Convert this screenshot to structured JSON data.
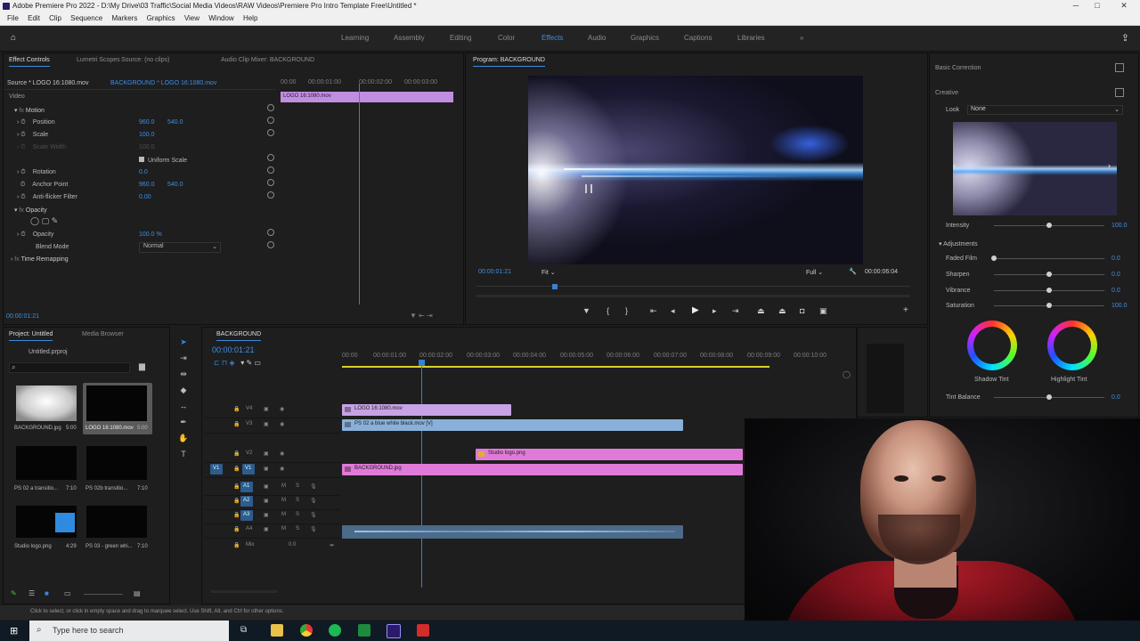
{
  "window": {
    "title": "Adobe Premiere Pro 2022 - D:\\My Drive\\03 Traffic\\Social Media Videos\\RAW Videos\\Premiere Pro Intro Template Free\\Untitled *",
    "controls": {
      "minimize": "─",
      "maximize": "□",
      "close": "✕"
    }
  },
  "menu": [
    "File",
    "Edit",
    "Clip",
    "Sequence",
    "Markers",
    "Graphics",
    "View",
    "Window",
    "Help"
  ],
  "workspaces": {
    "items": [
      "Learning",
      "Assembly",
      "Editing",
      "Color",
      "Effects",
      "Audio",
      "Graphics",
      "Captions",
      "Libraries"
    ],
    "active": "Effects",
    "more": "»"
  },
  "effect_controls": {
    "tabs": [
      "Effect Controls",
      "Lumetri Scopes",
      "Source: (no clips)",
      "Audio Clip Mixer: BACKGROUND"
    ],
    "source": "Source * LOGO 16:1080.mov",
    "sequence": "BACKGROUND * LOGO 16:1080.mov",
    "ruler": [
      "00:00",
      "00:00:01:00",
      "00:00:02:00",
      "00:00:03:00"
    ],
    "clip_name": "LOGO 16:1080.mov",
    "section_video": "Video",
    "motion": "Motion",
    "position": {
      "label": "Position",
      "x": "960.0",
      "y": "540.0"
    },
    "scale": {
      "label": "Scale",
      "value": "100.0"
    },
    "scale_width": {
      "label": "Scale Width",
      "value": "100.0"
    },
    "uniform_scale": "Uniform Scale",
    "rotation": {
      "label": "Rotation",
      "value": "0.0"
    },
    "anchor": {
      "label": "Anchor Point",
      "x": "960.0",
      "y": "540.0"
    },
    "antiflicker": {
      "label": "Anti-flicker Filter",
      "value": "0.00"
    },
    "opacity_section": "Opacity",
    "opacity": {
      "label": "Opacity",
      "value": "100.0 %"
    },
    "blend": {
      "label": "Blend Mode",
      "value": "Normal"
    },
    "time_remap": "Time Remapping",
    "timecode": "00:00:01:21"
  },
  "program": {
    "title": "Program: BACKGROUND",
    "timecode": "00:00:01:21",
    "fit": "Fit",
    "quality": "Full",
    "duration": "00:00:06:04",
    "controls": [
      "marker",
      "in",
      "out",
      "go-in",
      "step-back",
      "play",
      "step-forward",
      "go-out",
      "lift",
      "extract",
      "export-frame",
      "compare"
    ]
  },
  "lumetri": {
    "basic": "Basic Correction",
    "creative": "Creative",
    "look_label": "Look",
    "look_value": "None",
    "intensity": {
      "label": "Intensity",
      "value": "100.0"
    },
    "adjustments": "Adjustments",
    "sliders": [
      {
        "label": "Faded Film",
        "value": "0.0",
        "level": 0.0
      },
      {
        "label": "Sharpen",
        "value": "0.0",
        "level": 0.5
      },
      {
        "label": "Vibrance",
        "value": "0.0",
        "level": 0.5
      },
      {
        "label": "Saturation",
        "value": "100.0",
        "level": 0.5
      }
    ],
    "shadow_tint": "Shadow Tint",
    "highlight_tint": "Highlight Tint",
    "tint_balance": {
      "label": "Tint Balance",
      "value": "0.0"
    }
  },
  "project": {
    "tabs": [
      "Project: Untitled",
      "Media Browser"
    ],
    "project_file": "Untitled.prproj",
    "items": [
      {
        "name": "BACKGROUND.jpg",
        "meta": "5:00"
      },
      {
        "name": "LOGO 16:1080.mov",
        "meta": "5:00"
      },
      {
        "name": "PS 02 a transitio...",
        "meta": "7:10"
      },
      {
        "name": "PS 02b transitio...",
        "meta": "7:10"
      },
      {
        "name": "Studio logo.png",
        "meta": "4:29"
      },
      {
        "name": "PS 03 - green whi...",
        "meta": "7:10"
      }
    ]
  },
  "timeline": {
    "title": "BACKGROUND",
    "timecode": "00:00:01:21",
    "ruler": [
      "00:00",
      "00:00:01:00",
      "00:00:02:00",
      "00:00:03:00",
      "00:00:04:00",
      "00:00:05:00",
      "00:00:06:00",
      "00:00:07:00",
      "00:00:08:00",
      "00:00:09:00",
      "00:00:10:00"
    ],
    "video_tracks": [
      "V4",
      "V3",
      "V2",
      "V1"
    ],
    "audio_tracks": [
      "A1",
      "A2",
      "A3",
      "A4"
    ],
    "mix": {
      "label": "Mix",
      "value": "0.0"
    },
    "clips": [
      {
        "name": "LOGO 16:1080.mov",
        "track": "V4"
      },
      {
        "name": "PS 02 a blue white black.mov [V]",
        "track": "V3"
      },
      {
        "name": "Studio logo.png",
        "track": "V2"
      },
      {
        "name": "BACKGROUND.jpg",
        "track": "V1"
      }
    ],
    "src_patch": "V1",
    "target_patch": "V1"
  },
  "status": {
    "text": "Click to select, or click in empty space and drag to marquee select. Use Shift, Alt, and Ctrl for other options."
  },
  "taskbar": {
    "search_placeholder": "Type here to search"
  }
}
